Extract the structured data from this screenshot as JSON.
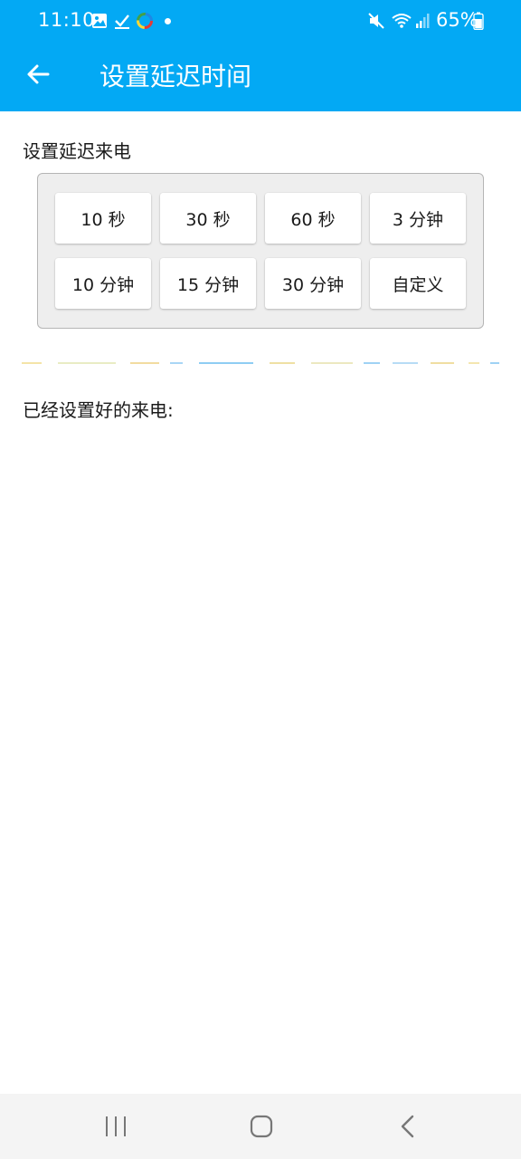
{
  "status_bar": {
    "time": "11:10",
    "battery": "65%",
    "icons": [
      "image-icon",
      "check-icon",
      "colorful-ring-icon",
      "notification-dot",
      "mute-icon",
      "wifi-calling-icon",
      "signal-icon",
      "battery-icon"
    ]
  },
  "app_bar": {
    "title": "设置延迟时间",
    "back_icon": "back-arrow-icon",
    "background_color": "#03A9F4"
  },
  "delay_section": {
    "label": "设置延迟来电",
    "options": [
      "10 秒",
      "30 秒",
      "60 秒",
      "3 分钟",
      "10 分钟",
      "15 分钟",
      "30 分钟",
      "自定义"
    ]
  },
  "configured_section": {
    "label": "已经设置好的来电:"
  },
  "nav_bar": {
    "icons": [
      "recent-apps-icon",
      "home-icon",
      "back-icon"
    ]
  }
}
